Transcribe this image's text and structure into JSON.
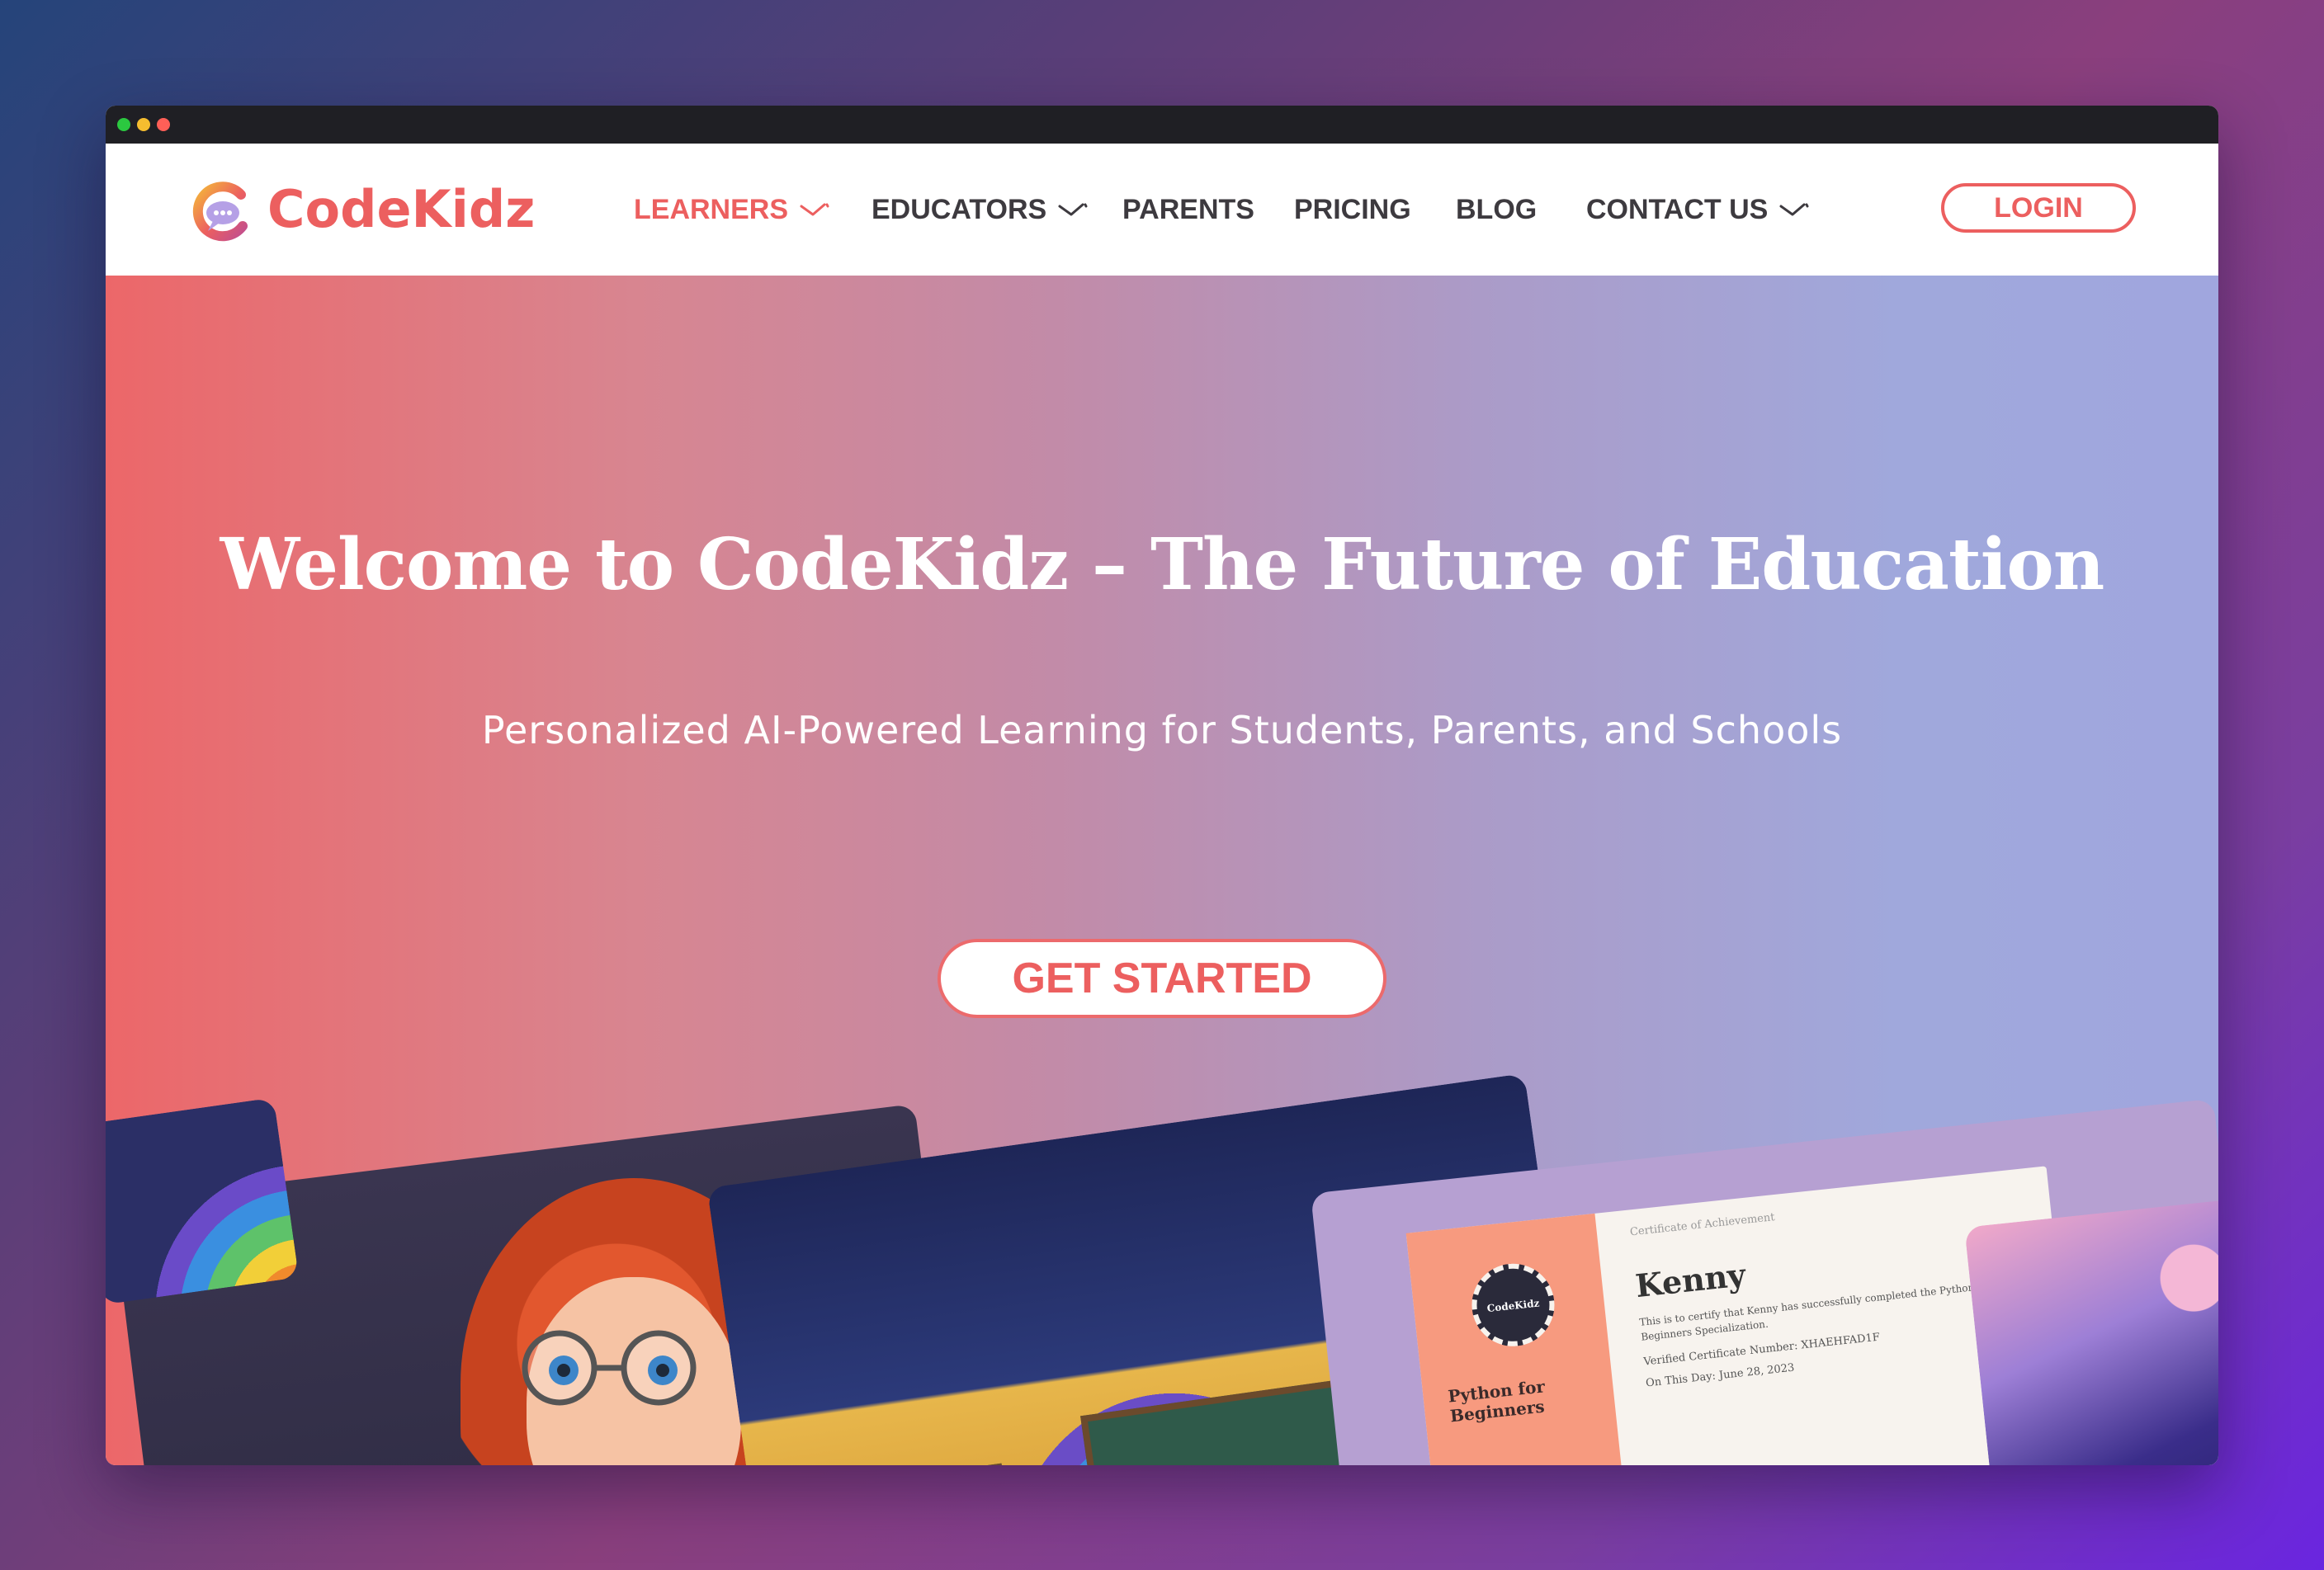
{
  "brand": {
    "name": "CodeKidz",
    "color": "#ec5f5f"
  },
  "nav": {
    "items": [
      {
        "label": "LEARNERS",
        "has_dropdown": true,
        "active": true
      },
      {
        "label": "EDUCATORS",
        "has_dropdown": true,
        "active": false
      },
      {
        "label": "PARENTS",
        "has_dropdown": false,
        "active": false
      },
      {
        "label": "PRICING",
        "has_dropdown": false,
        "active": false
      },
      {
        "label": "BLOG",
        "has_dropdown": false,
        "active": false
      },
      {
        "label": "CONTACT US",
        "has_dropdown": true,
        "active": false
      }
    ],
    "login_label": "LOGIN"
  },
  "hero": {
    "title": "Welcome to CodeKidz – The Future of Education",
    "subtitle": "Personalized AI-Powered Learning for Students, Parents, and Schools",
    "cta_label": "GET STARTED"
  },
  "certificate": {
    "seal_label": "CodeKidz",
    "heading": "Certificate of Achievement",
    "name": "Kenny",
    "body": "This is to certify that Kenny has successfully completed the Python for Beginners Specialization.",
    "verification": "Verified Certificate Number: XHAEHFAD1F",
    "date": "On This Day: June 28, 2023",
    "course": "Python for Beginners"
  },
  "colors": {
    "accent": "#ec5f5f",
    "nav_text": "#3d3a3f"
  }
}
